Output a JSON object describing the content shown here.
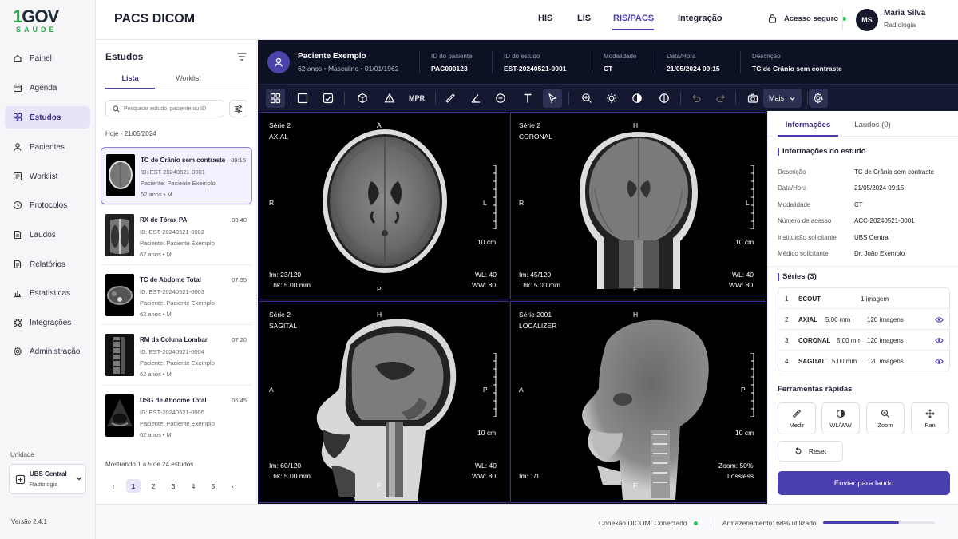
{
  "brand": {
    "logo_top": "1GOV",
    "logo_bottom": "SAÚDE"
  },
  "app": {
    "title": "PACS DICOM"
  },
  "sidebar": {
    "items": [
      {
        "label": "Painel",
        "icon": "home-icon"
      },
      {
        "label": "Agenda",
        "icon": "calendar-icon"
      },
      {
        "label": "Estudos",
        "icon": "grid-icon",
        "active": true
      },
      {
        "label": "Pacientes",
        "icon": "user-icon"
      },
      {
        "label": "Worklist",
        "icon": "list-icon"
      },
      {
        "label": "Protocolos",
        "icon": "protocol-icon"
      },
      {
        "label": "Laudos",
        "icon": "document-icon"
      },
      {
        "label": "Relatórios",
        "icon": "report-icon"
      },
      {
        "label": "Estatísticas",
        "icon": "bar-chart-icon"
      },
      {
        "label": "Integrações",
        "icon": "integration-icon"
      },
      {
        "label": "Administração",
        "icon": "gear-icon"
      }
    ],
    "unit_label": "Unidade",
    "unit_name": "UBS Central",
    "unit_dept": "Radiologia",
    "version": "Versão 2.4.1"
  },
  "topnav": {
    "items": [
      "HIS",
      "LIS",
      "RIS/PACS",
      "Integração"
    ],
    "active": "RIS/PACS",
    "secure": "Acesso seguro"
  },
  "user": {
    "initials": "MS",
    "name": "Maria Silva",
    "role": "Radiologia"
  },
  "studies": {
    "title": "Estudos",
    "tabs": [
      "Lista",
      "Worklist"
    ],
    "search_placeholder": "Pesquisar estudo, paciente ou ID",
    "date_header": "Hoje - 21/05/2024",
    "items": [
      {
        "title": "TC de Crânio sem contraste",
        "time": "09:15",
        "id": "ID: EST-20240521-0001",
        "patient": "Paciente: Paciente Exemplo",
        "age": "62 anos • M"
      },
      {
        "title": "RX de Tórax PA",
        "time": "08:40",
        "id": "ID: EST-20240521-0002",
        "patient": "Paciente: Paciente Exemplo",
        "age": "62 anos • M"
      },
      {
        "title": "TC de Abdome Total",
        "time": "07:55",
        "id": "ID: EST-20240521-0003",
        "patient": "Paciente: Paciente Exemplo",
        "age": "62 anos • M"
      },
      {
        "title": "RM da Coluna Lombar",
        "time": "07:20",
        "id": "ID: EST-20240521-0004",
        "patient": "Paciente: Paciente Exemplo",
        "age": "62 anos • M"
      },
      {
        "title": "USG de Abdome Total",
        "time": "06:45",
        "id": "ID: EST-20240521-0005",
        "patient": "Paciente: Paciente Exemplo",
        "age": "62 anos • M"
      }
    ],
    "showing": "Mostrando 1 a 5 de 24 estudos",
    "pages": [
      "1",
      "2",
      "3",
      "4",
      "5"
    ]
  },
  "patient": {
    "name": "Paciente Exemplo",
    "info": "62 anos • Masculino • 01/01/1962",
    "fields": [
      {
        "label": "ID do paciente",
        "value": "PAC000123"
      },
      {
        "label": "ID do estudo",
        "value": "EST-20240521-0001"
      },
      {
        "label": "Modalidade",
        "value": "CT"
      },
      {
        "label": "Data/Hora",
        "value": "21/05/2024  09:15"
      },
      {
        "label": "Descrição",
        "value": "TC de Crânio sem contraste"
      }
    ]
  },
  "toolbar": {
    "mpr": "MPR",
    "more": "Mais"
  },
  "viewports": [
    {
      "series": "Série 2",
      "plane": "AXIAL",
      "top": "A",
      "left": "R",
      "right": "L",
      "bottom": "P",
      "scale": "10 cm",
      "bl1": "Im: 23/120",
      "bl2": "Thk: 5.00 mm",
      "br1": "WL: 40",
      "br2": "WW: 80"
    },
    {
      "series": "Série 2",
      "plane": "CORONAL",
      "top": "H",
      "left": "R",
      "right": "L",
      "bottom": "F",
      "scale": "10 cm",
      "bl1": "Im: 45/120",
      "bl2": "Thk: 5.00 mm",
      "br1": "WL: 40",
      "br2": "WW: 80"
    },
    {
      "series": "Série 2",
      "plane": "SAGITAL",
      "top": "H",
      "left": "A",
      "right": "P",
      "bottom": "F",
      "scale": "10 cm",
      "bl1": "Im: 60/120",
      "bl2": "Thk: 5.00 mm",
      "br1": "WL: 40",
      "br2": "WW: 80"
    },
    {
      "series": "Série 2001",
      "plane": "LOCALIZER",
      "top": "H",
      "left": "A",
      "right": "P",
      "bottom": "F",
      "scale": "10 cm",
      "bl1": "Im: 1/1",
      "bl2": "",
      "br1": "Zoom: 50%",
      "br2": "Lossless"
    }
  ],
  "panel": {
    "tabs": [
      "Informações",
      "Laudos (0)"
    ],
    "info_title": "Informações do estudo",
    "info": [
      {
        "label": "Descrição",
        "value": "TC de Crânio sem contraste"
      },
      {
        "label": "Data/Hora",
        "value": "21/05/2024  09:15"
      },
      {
        "label": "Modalidade",
        "value": "CT"
      },
      {
        "label": "Número de acesso",
        "value": "ACC-20240521-0001"
      },
      {
        "label": "Instituição solicitante",
        "value": "UBS Central"
      },
      {
        "label": "Médico solicitante",
        "value": "Dr. João Exemplo"
      }
    ],
    "series_title": "Séries (3)",
    "series": [
      {
        "n": "1",
        "name": "SCOUT",
        "thk": "",
        "count": "1 imagem"
      },
      {
        "n": "2",
        "name": "AXIAL",
        "thk": "5.00 mm",
        "count": "120 imagens"
      },
      {
        "n": "3",
        "name": "CORONAL",
        "thk": "5.00 mm",
        "count": "120 imagens"
      },
      {
        "n": "4",
        "name": "SAGITAL",
        "thk": "5.00 mm",
        "count": "120 imagens"
      }
    ],
    "tools_title": "Ferramentas rápidas",
    "tools": [
      "Medir",
      "WL/WW",
      "Zoom",
      "Pan"
    ],
    "reset": "Reset",
    "send": "Enviar para laudo"
  },
  "footer": {
    "conn": "Conexão DICOM: Conectado",
    "storage": "Armazenamento: 68% utilizado",
    "storage_pct": 68
  }
}
